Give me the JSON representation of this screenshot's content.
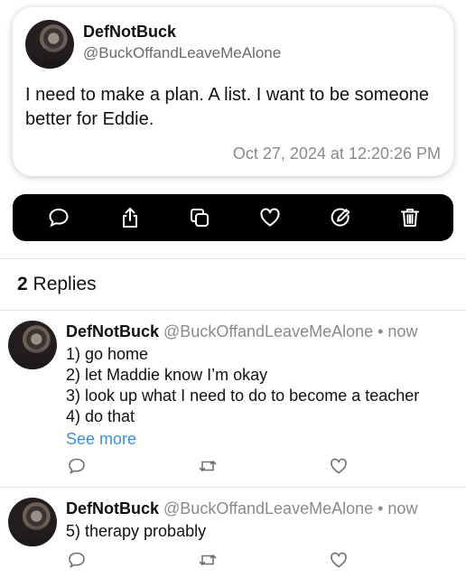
{
  "post": {
    "author_name": "DefNotBuck",
    "author_handle": "@BuckOffandLeaveMeAlone",
    "text": "I need to make a plan. A list. I want to be someone better for Eddie.",
    "timestamp": "Oct 27, 2024 at 12:20:26 PM"
  },
  "actions": [
    "comment-icon",
    "share-icon",
    "copy-icon",
    "heart-icon",
    "edit-icon",
    "trash-icon"
  ],
  "replies_header": {
    "count": "2",
    "label": "Replies"
  },
  "replies": [
    {
      "author_name": "DefNotBuck",
      "meta": "@BuckOffandLeaveMeAlone • now",
      "lines": [
        "1) go home",
        "2) let Maddie know I’m okay",
        "3) look up what I need to do to become a teacher",
        "4) do that"
      ],
      "see_more": "See more"
    },
    {
      "author_name": "DefNotBuck",
      "meta": "@BuckOffandLeaveMeAlone • now",
      "lines": [
        "5) therapy probably"
      ]
    }
  ],
  "colors": {
    "link": "#3a8fd9",
    "action_bar": "#000000",
    "muted": "#8a8a8a"
  }
}
